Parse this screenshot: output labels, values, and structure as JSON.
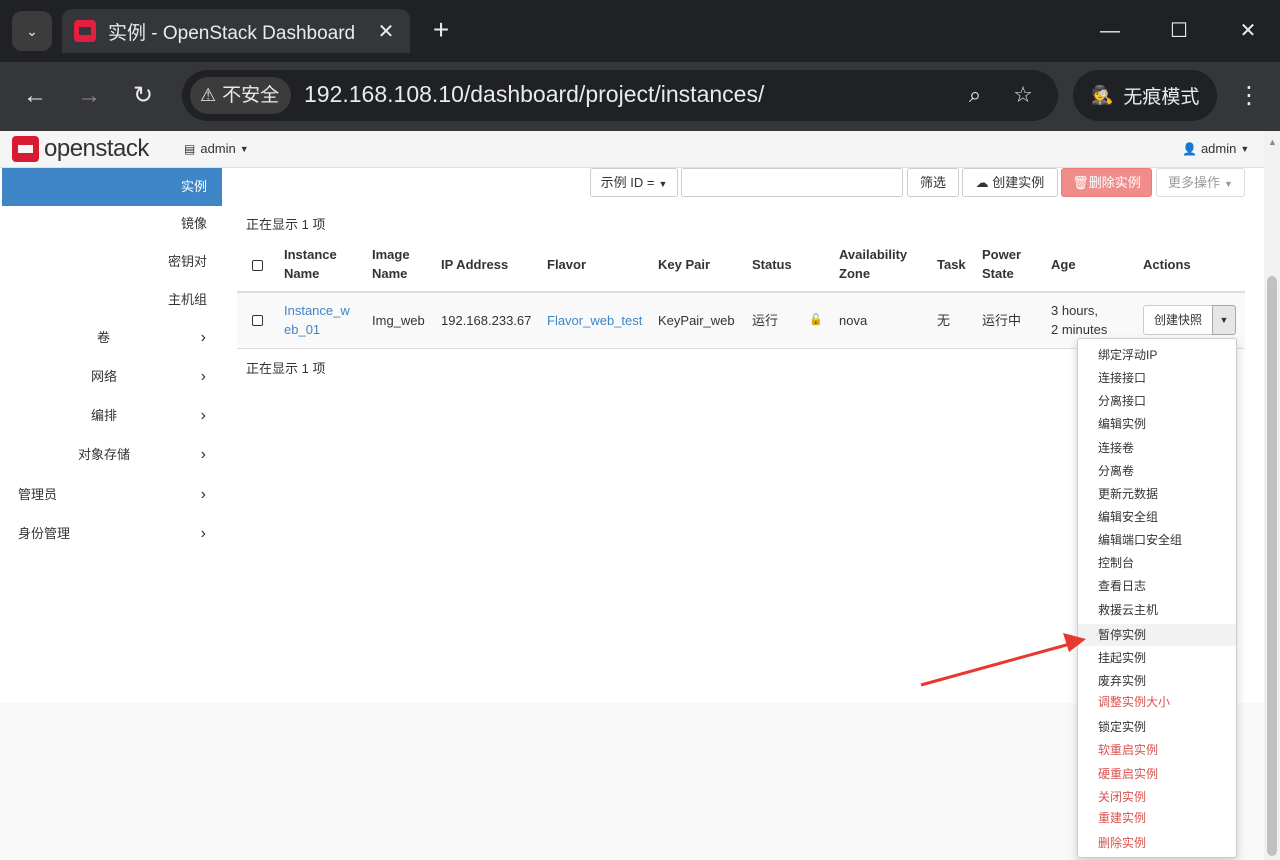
{
  "browser": {
    "tab_title": "实例 - OpenStack Dashboard",
    "new_tab": "+",
    "security_label": "不安全",
    "url": "192.168.108.10/dashboard/project/instances/",
    "incognito_label": "无痕模式"
  },
  "header": {
    "logo_text": "openstack",
    "project_menu": "admin",
    "user_menu": "admin"
  },
  "sidebar": {
    "active": "实例",
    "sub_items": [
      "镜像",
      "密钥对",
      "主机组"
    ],
    "groups": [
      "卷",
      "网络",
      "编排",
      "对象存储"
    ],
    "top_groups": [
      "管理员",
      "身份管理"
    ]
  },
  "filter": {
    "select_label": "示例 ID =",
    "input_value": "",
    "filter_button": "筛选",
    "create_button": "创建实例",
    "delete_button": "删除实例",
    "more_button": "更多操作"
  },
  "table": {
    "count_top": "正在显示 1 项",
    "count_bottom": "正在显示 1 项",
    "headers": {
      "name": [
        "Instance",
        "Name"
      ],
      "image": [
        "Image",
        "Name"
      ],
      "ip": "IP Address",
      "flavor": "Flavor",
      "keypair": "Key Pair",
      "status": "Status",
      "zone": [
        "Availability",
        "Zone"
      ],
      "task": "Task",
      "power": [
        "Power",
        "State"
      ],
      "age": "Age",
      "actions": "Actions"
    },
    "rows": [
      {
        "name": [
          "Instance_w",
          "eb_01"
        ],
        "image": "Img_web",
        "ip": "192.168.233.67",
        "flavor": "Flavor_web_test",
        "keypair": "KeyPair_web",
        "status": "运行",
        "zone": "nova",
        "task": "无",
        "power": "运行中",
        "age": [
          "3 hours,",
          "2 minutes"
        ],
        "action": "创建快照"
      }
    ]
  },
  "dropdown": {
    "items": [
      {
        "label": "绑定浮动IP",
        "danger": false
      },
      {
        "label": "连接接口",
        "danger": false
      },
      {
        "label": "分离接口",
        "danger": false
      },
      {
        "label": "编辑实例",
        "danger": false
      },
      {
        "label": "连接卷",
        "danger": false
      },
      {
        "label": "分离卷",
        "danger": false
      },
      {
        "label": "更新元数据",
        "danger": false
      },
      {
        "label": "编辑安全组",
        "danger": false
      },
      {
        "label": "编辑端口安全组",
        "danger": false
      },
      {
        "label": "控制台",
        "danger": false
      },
      {
        "label": "查看日志",
        "danger": false
      },
      {
        "label": "救援云主机",
        "danger": false
      },
      {
        "label": "暂停实例",
        "danger": false,
        "highlighted": true
      },
      {
        "label": "挂起实例",
        "danger": false
      },
      {
        "label": "废弃实例",
        "danger": false
      },
      {
        "label": "调整实例大小",
        "danger": true
      },
      {
        "label": "锁定实例",
        "danger": false
      },
      {
        "label": "软重启实例",
        "danger": true
      },
      {
        "label": "硬重启实例",
        "danger": true
      },
      {
        "label": "关闭实例",
        "danger": true
      },
      {
        "label": "重建实例",
        "danger": true
      },
      {
        "label": "删除实例",
        "danger": true
      }
    ]
  },
  "colors": {
    "accent": "#3f86c8",
    "danger": "#d9534f",
    "brand": "#da1a32",
    "annotation_arrow": "#e8382f"
  }
}
